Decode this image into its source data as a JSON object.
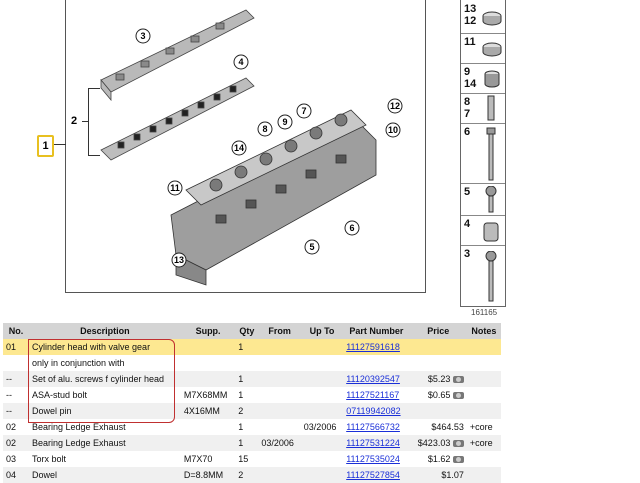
{
  "diagram": {
    "callouts": [
      "1",
      "2",
      "3",
      "4",
      "5",
      "6",
      "7",
      "8",
      "9",
      "10",
      "11",
      "12",
      "13",
      "14"
    ],
    "figure_id": "161165"
  },
  "strip": [
    {
      "nums": [
        "13",
        "12"
      ],
      "icon": "cap-icon"
    },
    {
      "nums": [
        "11"
      ],
      "icon": "cap-icon"
    },
    {
      "nums": [
        "9",
        "14"
      ],
      "icon": "seal-icon"
    },
    {
      "nums": [
        "8",
        "7"
      ],
      "icon": "dowel-icon"
    },
    {
      "nums": [
        "6"
      ],
      "icon": "long-bolt-icon"
    },
    {
      "nums": [
        "5"
      ],
      "icon": "short-bolt-icon"
    },
    {
      "nums": [
        "4"
      ],
      "icon": "sleeve-icon"
    },
    {
      "nums": [
        "3"
      ],
      "icon": "stud-bolt-icon"
    }
  ],
  "table": {
    "headers": [
      "No.",
      "Description",
      "Supp.",
      "Qty",
      "From",
      "Up To",
      "Part Number",
      "Price",
      "Notes"
    ],
    "rows": [
      {
        "no": "01",
        "desc": "Cylinder head with valve gear",
        "supp": "",
        "qty": "1",
        "from": "",
        "upto": "",
        "pn": "11127591618",
        "price": "",
        "notes": "",
        "photo": false
      },
      {
        "no": "",
        "desc": "only in conjunction with",
        "supp": "",
        "qty": "",
        "from": "",
        "upto": "",
        "pn": "",
        "price": "",
        "notes": "",
        "photo": false
      },
      {
        "no": "--",
        "desc": "Set of alu. screws f cylinder head",
        "supp": "",
        "qty": "1",
        "from": "",
        "upto": "",
        "pn": "11120392547",
        "price": "$5.23",
        "notes": "",
        "photo": true
      },
      {
        "no": "--",
        "desc": "ASA-stud bolt",
        "supp": "M7X68MM",
        "qty": "1",
        "from": "",
        "upto": "",
        "pn": "11127521167",
        "price": "$0.65",
        "notes": "",
        "photo": true
      },
      {
        "no": "--",
        "desc": "Dowel pin",
        "supp": "4X16MM",
        "qty": "2",
        "from": "",
        "upto": "",
        "pn": "07119942082",
        "price": "",
        "notes": "",
        "photo": false
      },
      {
        "no": "02",
        "desc": "Bearing Ledge Exhaust",
        "supp": "",
        "qty": "1",
        "from": "",
        "upto": "03/2006",
        "pn": "11127566732",
        "price": "$464.53",
        "notes": "+core",
        "photo": false
      },
      {
        "no": "02",
        "desc": "Bearing Ledge Exhaust",
        "supp": "",
        "qty": "1",
        "from": "03/2006",
        "upto": "",
        "pn": "11127531224",
        "price": "$423.03",
        "notes": "+core",
        "photo": true
      },
      {
        "no": "03",
        "desc": "Torx bolt",
        "supp": "M7X70",
        "qty": "15",
        "from": "",
        "upto": "",
        "pn": "11127535024",
        "price": "$1.62",
        "notes": "",
        "photo": true
      },
      {
        "no": "04",
        "desc": "Dowel",
        "supp": "D=8.8MM",
        "qty": "2",
        "from": "",
        "upto": "",
        "pn": "11127527854",
        "price": "$1.07",
        "notes": "",
        "photo": false
      }
    ]
  }
}
